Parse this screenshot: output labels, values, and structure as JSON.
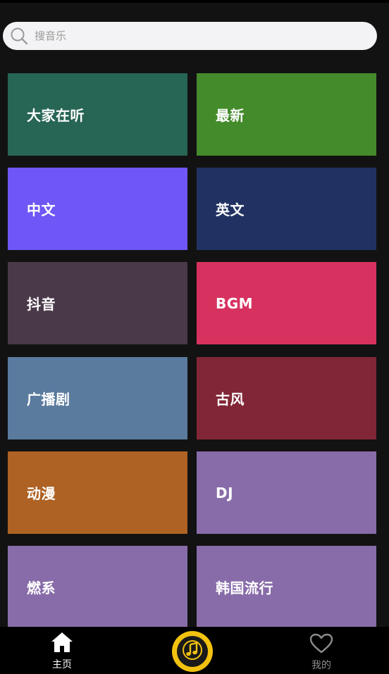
{
  "search": {
    "placeholder": "搜音乐",
    "value": ""
  },
  "categories": [
    {
      "label": "大家在听",
      "color": "#276555"
    },
    {
      "label": "最新",
      "color": "#448b2b"
    },
    {
      "label": "中文",
      "color": "#6e57f6"
    },
    {
      "label": "英文",
      "color": "#213262"
    },
    {
      "label": "抖音",
      "color": "#4a3949"
    },
    {
      "label": "BGM",
      "color": "#d7325f"
    },
    {
      "label": "广播剧",
      "color": "#5a7b9e"
    },
    {
      "label": "古风",
      "color": "#812636"
    },
    {
      "label": "动漫",
      "color": "#ae6224"
    },
    {
      "label": "DJ",
      "color": "#886ca9"
    },
    {
      "label": "燃系",
      "color": "#886ca9"
    },
    {
      "label": "韩国流行",
      "color": "#886ca9"
    }
  ],
  "nav": {
    "home_label": "主页",
    "mine_label": "我的",
    "active_color": "#ffffff",
    "inactive_color": "#8c8c8c",
    "player_color": "#f2c20f"
  }
}
